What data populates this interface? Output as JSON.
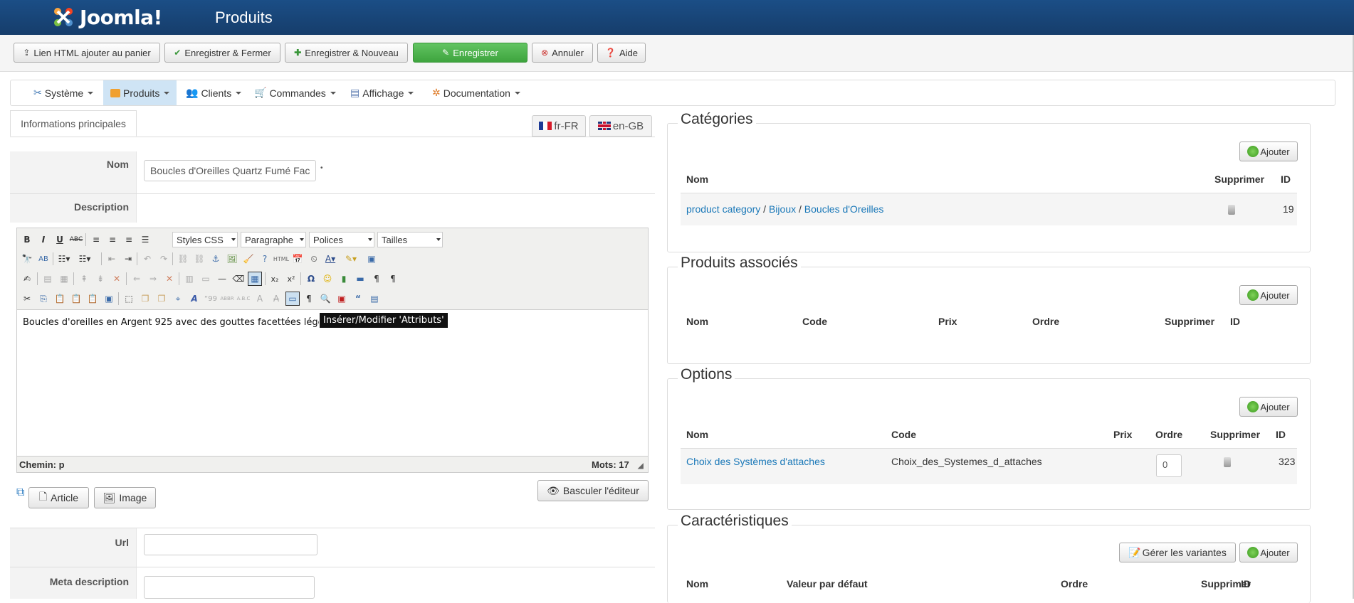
{
  "header": {
    "logo_text": "Joomla!",
    "title": "Produits"
  },
  "toolbar": {
    "buttons": [
      {
        "label": "Lien HTML ajouter au panier",
        "icon": "upload-icon"
      },
      {
        "label": "Enregistrer & Fermer",
        "icon": "check-icon"
      },
      {
        "label": "Enregistrer & Nouveau",
        "icon": "plus-icon"
      },
      {
        "label": "Enregistrer",
        "icon": "edit-icon"
      },
      {
        "label": "Annuler",
        "icon": "cancel-icon"
      },
      {
        "label": "Aide",
        "icon": "help-icon"
      }
    ],
    "save_color": "#4cae4c"
  },
  "menu": {
    "items": [
      {
        "label": "Système",
        "icon": "tools-icon"
      },
      {
        "label": "Produits",
        "icon": "box-icon"
      },
      {
        "label": "Clients",
        "icon": "users-icon"
      },
      {
        "label": "Commandes",
        "icon": "cart-icon"
      },
      {
        "label": "Affichage",
        "icon": "display-icon"
      },
      {
        "label": "Documentation",
        "icon": "docs-icon"
      }
    ]
  },
  "tabs": {
    "main": "Informations principales",
    "lang_fr": "fr-FR",
    "lang_en": "en-GB"
  },
  "form": {
    "name_label": "Nom",
    "name_value": "Boucles d'Oreilles Quartz Fumé Fac",
    "required_mark": "•",
    "description_label": "Description",
    "url_label": "Url",
    "meta_label": "Meta description"
  },
  "editor": {
    "styles": "Styles CSS",
    "format": "Paragraphe",
    "fonts": "Polices",
    "sizes": "Tailles",
    "content": "Boucles d'oreilles en Argent 925 avec des gouttes facettées légèrement",
    "path": "Chemin: p",
    "words": "Mots: 17",
    "tooltip": "Insérer/Modifier 'Attributs'",
    "toggle_button": "Basculer l'éditeur",
    "article_button": "Article",
    "image_button": "Image"
  },
  "categories": {
    "legend": "Catégories",
    "add": "Ajouter",
    "headers": {
      "name": "Nom",
      "delete": "Supprimer",
      "id": "ID"
    },
    "rows": [
      {
        "path": [
          "product category",
          "Bijoux",
          "Boucles d'Oreilles"
        ],
        "sep": " / ",
        "id": "19"
      }
    ]
  },
  "associated": {
    "legend": "Produits associés",
    "add": "Ajouter",
    "headers": {
      "name": "Nom",
      "code": "Code",
      "price": "Prix",
      "order": "Ordre",
      "delete": "Supprimer",
      "id": "ID"
    }
  },
  "options": {
    "legend": "Options",
    "add": "Ajouter",
    "headers": {
      "name": "Nom",
      "code": "Code",
      "price": "Prix",
      "order": "Ordre",
      "delete": "Supprimer",
      "id": "ID"
    },
    "rows": [
      {
        "name": "Choix des Systèmes d'attaches",
        "code": "Choix_des_Systemes_d_attaches",
        "order": "0",
        "id": "323"
      }
    ]
  },
  "characteristics": {
    "legend": "Caractéristiques",
    "variants": "Gérer les variantes",
    "add": "Ajouter",
    "headers": {
      "name": "Nom",
      "default": "Valeur par défaut",
      "order": "Ordre",
      "delete": "Supprimer",
      "id": "ID"
    }
  }
}
